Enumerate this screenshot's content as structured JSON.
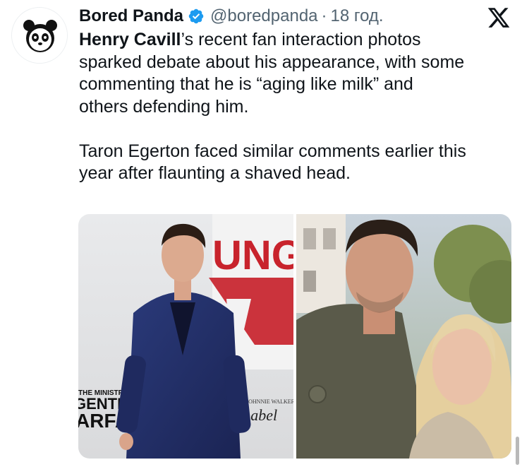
{
  "tweet": {
    "author": {
      "display_name": "Bored Panda",
      "handle": "@boredpanda",
      "verified": true,
      "avatar_icon": "panda-logo-icon"
    },
    "separator": "·",
    "timestamp": "18 год.",
    "platform_icon": "x-logo-icon",
    "text": {
      "mention": "Henry Cavill",
      "line1_rest": "’s recent fan interaction photos",
      "line2": "sparked debate about his appearance, with some",
      "line3": "commenting that he is “aging like milk” and",
      "line4": "others defending him.",
      "line5": "Taron Egerton faced similar comments earlier this",
      "line6": "year after flaunting a shaved head."
    },
    "media": {
      "photo_left": {
        "banner_title": "UNG",
        "banner_sub": "THE MINISTRY OF",
        "banner_line2": "GENTLEMA",
        "banner_line3": "ARFA",
        "sponsor_small": "JOHNNIE WALKER",
        "sponsor_script": "Label"
      },
      "photo_right": {}
    }
  },
  "colors": {
    "text_primary": "#0f1419",
    "text_secondary": "#536471",
    "verified_blue": "#1d9bf0",
    "banner_red": "#c8232c"
  }
}
